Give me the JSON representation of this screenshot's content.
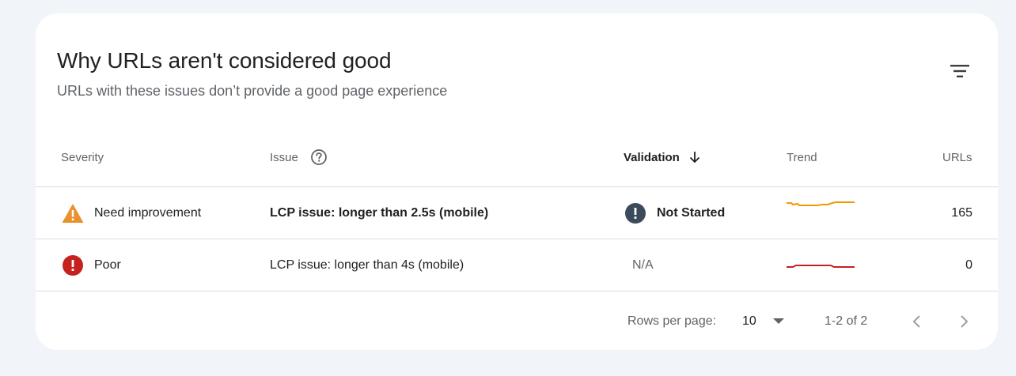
{
  "panel": {
    "title": "Why URLs aren't considered good",
    "subtitle": "URLs with these issues don’t provide a good page experience",
    "filter_icon": "filter-icon"
  },
  "table": {
    "columns": {
      "severity": "Severity",
      "issue": "Issue",
      "validation": "Validation",
      "trend": "Trend",
      "urls": "URLs"
    },
    "sort": {
      "column": "validation",
      "direction": "descending"
    },
    "rows": [
      {
        "severity": "Need improvement",
        "severity_icon": "warning-icon",
        "severity_color": "#e8912d",
        "issue": "LCP issue: longer than 2.5s (mobile)",
        "validation": "Not Started",
        "validation_icon": "exclamation-icon",
        "trend_color": "#f29900",
        "urls": "165"
      },
      {
        "severity": "Poor",
        "severity_icon": "error-icon",
        "severity_color": "#c5221f",
        "issue": "LCP issue: longer than 4s (mobile)",
        "validation": "N/A",
        "trend_color": "#c5221f",
        "urls": "0"
      }
    ]
  },
  "pagination": {
    "rows_per_page_label": "Rows per page:",
    "rows_per_page_value": "10",
    "range": "1-2 of 2"
  }
}
